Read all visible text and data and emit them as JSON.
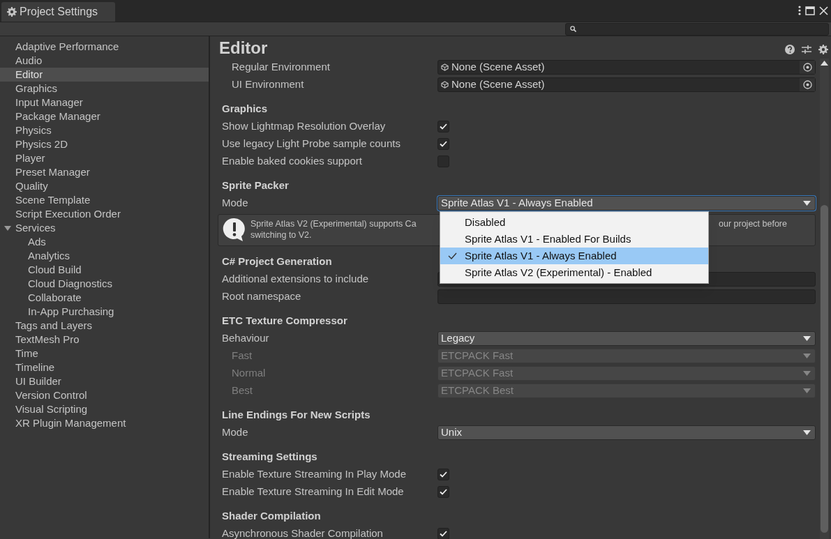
{
  "window": {
    "title": "Project Settings"
  },
  "sidebar": {
    "items": [
      {
        "label": "Adaptive Performance",
        "selected": false
      },
      {
        "label": "Audio",
        "selected": false
      },
      {
        "label": "Editor",
        "selected": true
      },
      {
        "label": "Graphics",
        "selected": false
      },
      {
        "label": "Input Manager",
        "selected": false
      },
      {
        "label": "Package Manager",
        "selected": false
      },
      {
        "label": "Physics",
        "selected": false
      },
      {
        "label": "Physics 2D",
        "selected": false
      },
      {
        "label": "Player",
        "selected": false
      },
      {
        "label": "Preset Manager",
        "selected": false
      },
      {
        "label": "Quality",
        "selected": false
      },
      {
        "label": "Scene Template",
        "selected": false
      },
      {
        "label": "Script Execution Order",
        "selected": false
      },
      {
        "label": "Services",
        "selected": false,
        "expanded": true,
        "children": [
          {
            "label": "Ads",
            "selected": false
          },
          {
            "label": "Analytics",
            "selected": false
          },
          {
            "label": "Cloud Build",
            "selected": false
          },
          {
            "label": "Cloud Diagnostics",
            "selected": false
          },
          {
            "label": "Collaborate",
            "selected": false
          },
          {
            "label": "In-App Purchasing",
            "selected": false
          }
        ]
      },
      {
        "label": "Tags and Layers",
        "selected": false
      },
      {
        "label": "TextMesh Pro",
        "selected": false
      },
      {
        "label": "Time",
        "selected": false
      },
      {
        "label": "Timeline",
        "selected": false
      },
      {
        "label": "UI Builder",
        "selected": false
      },
      {
        "label": "Version Control",
        "selected": false
      },
      {
        "label": "Visual Scripting",
        "selected": false
      },
      {
        "label": "XR Plugin Management",
        "selected": false
      }
    ]
  },
  "page": {
    "title": "Editor"
  },
  "sections": [
    {
      "rows": [
        {
          "kind": "object",
          "label": "Regular Environment",
          "value": "None (Scene Asset)",
          "indented": true
        },
        {
          "kind": "object",
          "label": "UI Environment",
          "value": "None (Scene Asset)",
          "indented": true
        }
      ]
    },
    {
      "title": "Graphics",
      "rows": [
        {
          "kind": "toggle",
          "label": "Show Lightmap Resolution Overlay",
          "checked": true
        },
        {
          "kind": "toggle",
          "label": "Use legacy Light Probe sample counts",
          "checked": true
        },
        {
          "kind": "toggle",
          "label": "Enable baked cookies support",
          "checked": false
        }
      ]
    },
    {
      "title": "Sprite Packer",
      "rows": [
        {
          "kind": "popup",
          "label": "Mode",
          "value": "Sprite Atlas V1 - Always Enabled",
          "disabled": false,
          "indented": false,
          "open": true
        },
        {
          "kind": "help",
          "text_start": "Sprite Atlas V2 (Experimental) supports Ca",
          "text_end": "our project before",
          "text_line2": "switching to V2."
        }
      ]
    },
    {
      "title": "C# Project Generation",
      "rows": [
        {
          "kind": "text",
          "label": "Additional extensions to include"
        },
        {
          "kind": "text",
          "label": "Root namespace"
        }
      ]
    },
    {
      "title": "ETC Texture Compressor",
      "rows": [
        {
          "kind": "popup",
          "label": "Behaviour",
          "value": "Legacy",
          "disabled": false,
          "indented": false
        },
        {
          "kind": "popup",
          "label": "Fast",
          "value": "ETCPACK Fast",
          "disabled": true,
          "indented": true
        },
        {
          "kind": "popup",
          "label": "Normal",
          "value": "ETCPACK Fast",
          "disabled": true,
          "indented": true
        },
        {
          "kind": "popup",
          "label": "Best",
          "value": "ETCPACK Best",
          "disabled": true,
          "indented": true
        }
      ]
    },
    {
      "title": "Line Endings For New Scripts",
      "rows": [
        {
          "kind": "popup",
          "label": "Mode",
          "value": "Unix",
          "disabled": false,
          "indented": false
        }
      ]
    },
    {
      "title": "Streaming Settings",
      "rows": [
        {
          "kind": "toggle",
          "label": "Enable Texture Streaming In Play Mode",
          "checked": true
        },
        {
          "kind": "toggle",
          "label": "Enable Texture Streaming In Edit Mode",
          "checked": true
        }
      ]
    },
    {
      "title": "Shader Compilation",
      "rows": [
        {
          "kind": "toggle",
          "label": "Asynchronous Shader Compilation",
          "checked": true
        }
      ]
    }
  ],
  "dropdown": {
    "options": [
      {
        "label": "Disabled",
        "selected": false
      },
      {
        "label": "Sprite Atlas V1 - Enabled For Builds",
        "selected": false
      },
      {
        "label": "Sprite Atlas V1 - Always Enabled",
        "selected": true
      },
      {
        "label": "Sprite Atlas V2 (Experimental) - Enabled",
        "selected": false
      }
    ]
  }
}
